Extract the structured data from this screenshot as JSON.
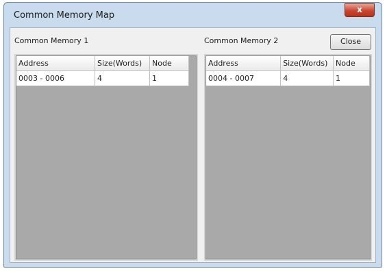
{
  "window": {
    "title": "Common Memory Map",
    "close_glyph": "x"
  },
  "panels": {
    "left": {
      "label": "Common Memory 1",
      "columns": [
        "Address",
        "Size(Words)",
        "Node"
      ],
      "rows": [
        [
          "0003 - 0006",
          "4",
          "1"
        ]
      ]
    },
    "right": {
      "label": "Common Memory 2",
      "columns": [
        "Address",
        "Size(Words)",
        "Node"
      ],
      "rows": [
        [
          "0004 - 0007",
          "4",
          "1"
        ]
      ]
    }
  },
  "buttons": {
    "close_label": "Close"
  }
}
